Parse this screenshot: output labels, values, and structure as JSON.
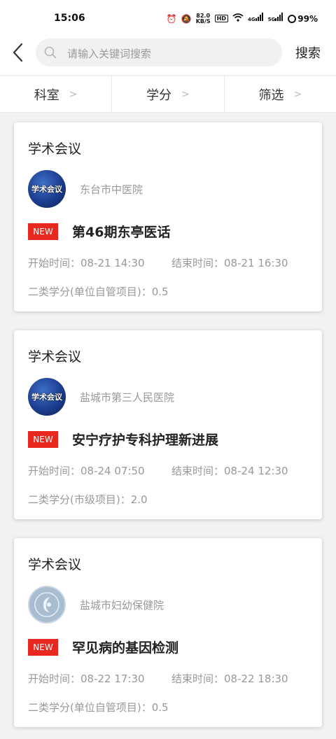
{
  "status_bar": {
    "time": "15:06",
    "speed": "82.0",
    "speed_unit": "KB/S",
    "hd": "HD",
    "net1": "4G",
    "net2": "5G",
    "battery": "99%"
  },
  "search": {
    "placeholder": "请输入关键词搜索",
    "button_label": "搜索"
  },
  "filters": [
    {
      "label": "科室"
    },
    {
      "label": "学分"
    },
    {
      "label": "筛选"
    }
  ],
  "cards": [
    {
      "category": "学术会议",
      "avatar_text": "学术会议",
      "organization": "东台市中医院",
      "tag": "NEW",
      "title": "第46期东亭医话",
      "start": "开始时间：08-21 14:30",
      "end": "结束时间：08-21 16:30",
      "credit": "二类学分(单位自管项目)：0.5"
    },
    {
      "category": "学术会议",
      "avatar_text": "学术会议",
      "organization": "盐城市第三人民医院",
      "tag": "NEW",
      "title": "安宁疗护专科护理新进展",
      "start": "开始时间：08-24 07:50",
      "end": "结束时间：08-24 12:30",
      "credit": "二类学分(市级项目)：2.0"
    },
    {
      "category": "学术会议",
      "organization": "盐城市妇幼保健院",
      "tag": "NEW",
      "title": "罕见病的基因检测",
      "start": "开始时间：08-22 17:30",
      "end": "结束时间：08-22 18:30",
      "credit": "二类学分(单位自管项目)：0.5"
    }
  ],
  "colors": {
    "new_tag": "#e8281e",
    "secondary_text": "#999999"
  }
}
